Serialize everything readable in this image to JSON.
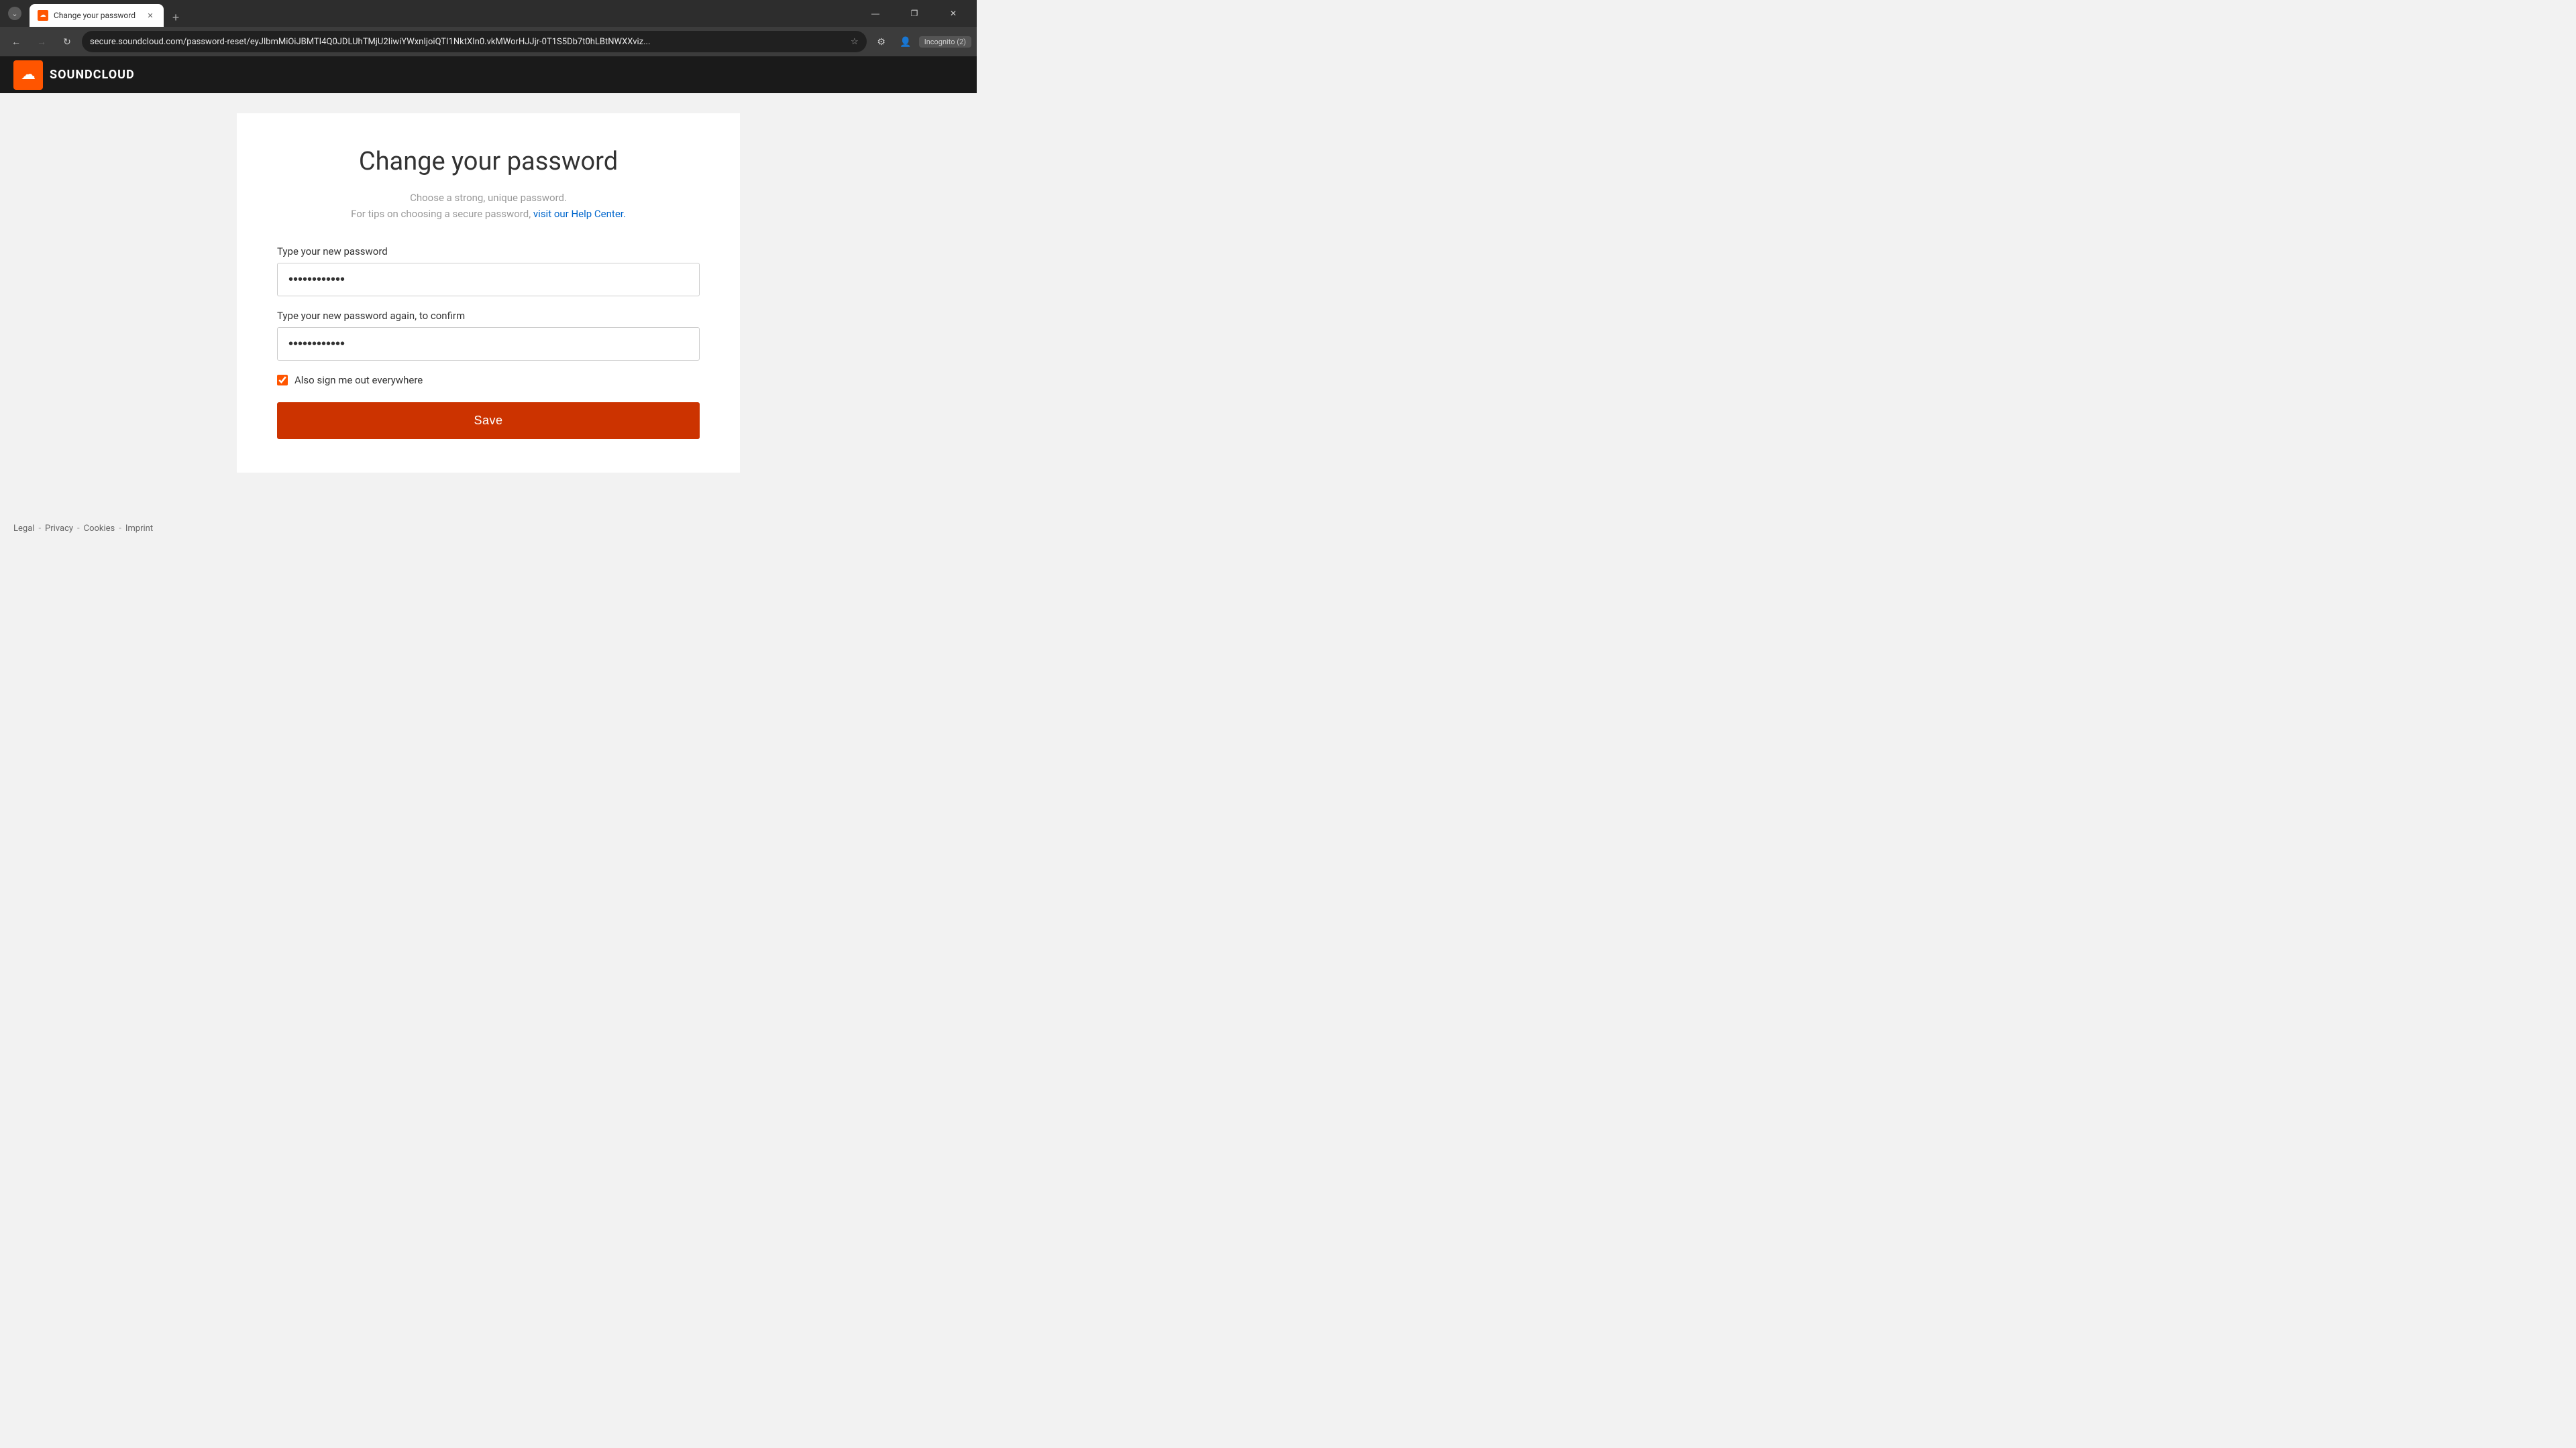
{
  "browser": {
    "tab": {
      "title": "Change your password",
      "favicon_color": "#ff5500"
    },
    "address": "secure.soundcloud.com/password-reset/eyJlbmMiOiJBMTI4Q0JDLUhTMjU2IiwiYWxnIjoiQTI1NktXIn0.vkMWorHJJjr-0T1S5Db7t0hLBtNWXXviz...",
    "incognito_label": "Incognito (2)",
    "nav": {
      "back_disabled": false,
      "forward_disabled": true
    }
  },
  "header": {
    "logo_text": "SOUNDCLOUD"
  },
  "page": {
    "title": "Change your password",
    "subtitle_line1": "Choose a strong, unique password.",
    "subtitle_line2": "For tips on choosing a secure password,",
    "help_link_text": "visit our Help Center.",
    "new_password_label": "Type your new password",
    "new_password_placeholder": "············",
    "confirm_password_label": "Type your new password again, to confirm",
    "confirm_password_placeholder": "············",
    "checkbox_label": "Also sign me out everywhere",
    "checkbox_checked": true,
    "save_button_label": "Save"
  },
  "footer": {
    "links": [
      {
        "label": "Legal"
      },
      {
        "separator": "-"
      },
      {
        "label": "Privacy"
      },
      {
        "separator": "-"
      },
      {
        "label": "Cookies"
      },
      {
        "separator": "-"
      },
      {
        "label": "Imprint"
      }
    ]
  },
  "icons": {
    "back": "←",
    "forward": "→",
    "refresh": "↻",
    "star": "☆",
    "extensions": "⚙",
    "profile": "👤",
    "minimize": "—",
    "maximize": "❐",
    "close": "✕",
    "new_tab": "+",
    "tab_close": "✕",
    "cloud": "☁"
  }
}
